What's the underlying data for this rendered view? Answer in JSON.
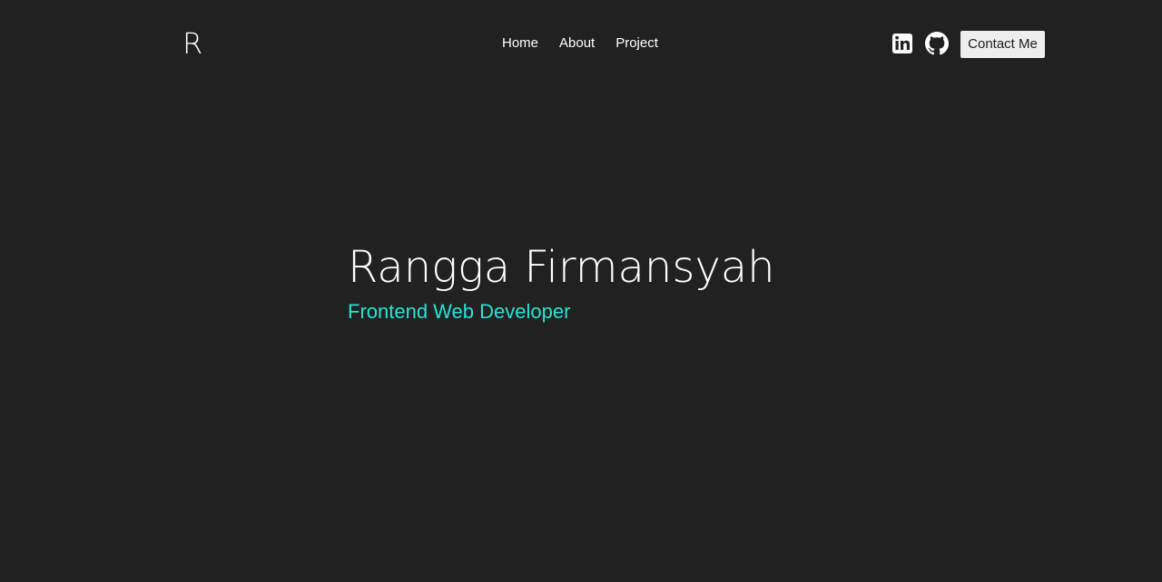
{
  "nav": {
    "logo": "R",
    "links": [
      "Home",
      "About",
      "Project"
    ],
    "social_icons": [
      "linkedin-icon",
      "github-icon"
    ],
    "contact_label": "Contact Me"
  },
  "hero": {
    "name": "Rangga Firmansyah",
    "title": "Frontend Web Developer"
  },
  "colors": {
    "background": "#212121",
    "text": "#ffffff",
    "accent": "#27e3d4",
    "button_bg": "#eeeeee",
    "button_text": "#1c1c1c"
  }
}
